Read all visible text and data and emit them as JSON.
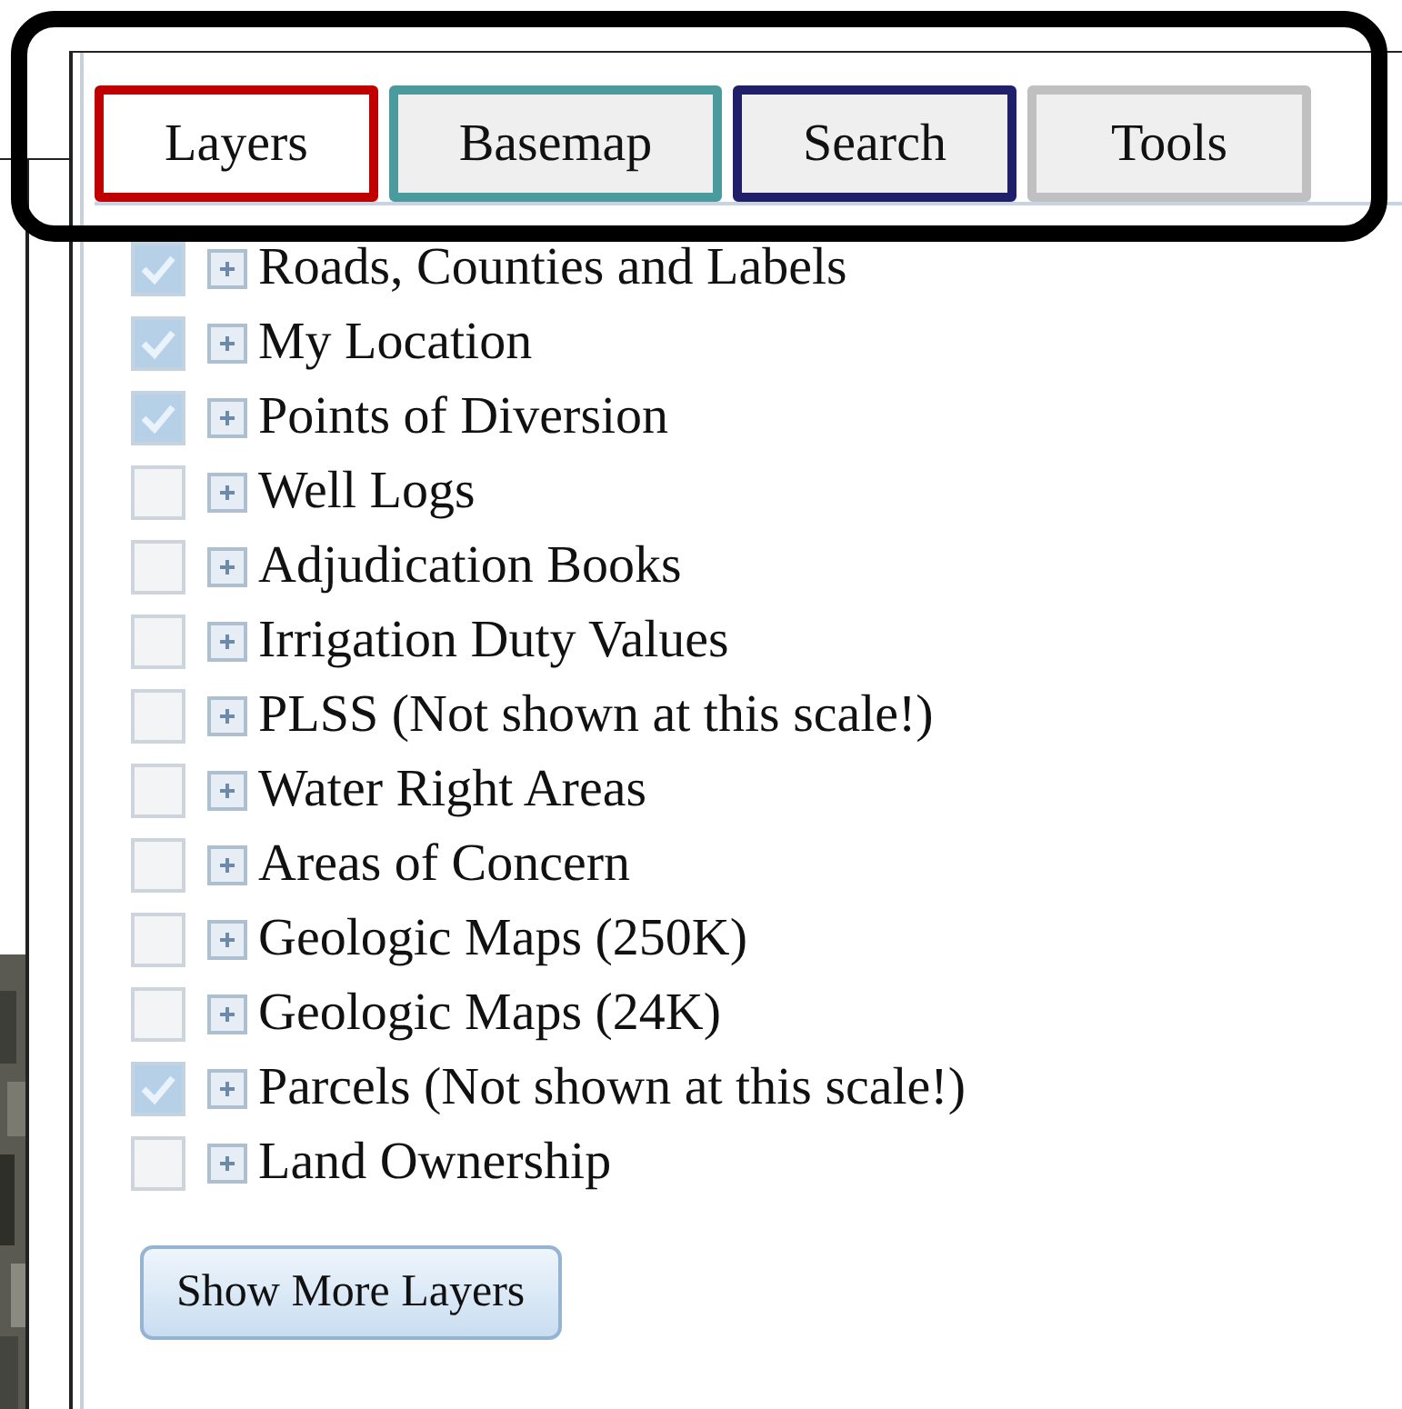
{
  "tabs": [
    {
      "label": "Layers",
      "selected": true,
      "color": "#c00000"
    },
    {
      "label": "Basemap",
      "selected": false,
      "color": "#4a9a9e"
    },
    {
      "label": "Search",
      "selected": false,
      "color": "#20206a"
    },
    {
      "label": "Tools",
      "selected": false,
      "color": "#c0c0c0"
    }
  ],
  "layers": [
    {
      "label": "Roads, Counties and Labels",
      "checked": true
    },
    {
      "label": "My Location",
      "checked": true
    },
    {
      "label": "Points of Diversion",
      "checked": true
    },
    {
      "label": "Well Logs",
      "checked": false
    },
    {
      "label": "Adjudication Books",
      "checked": false
    },
    {
      "label": "Irrigation Duty Values",
      "checked": false
    },
    {
      "label": "PLSS (Not shown at this scale!)",
      "checked": false
    },
    {
      "label": "Water Right Areas",
      "checked": false
    },
    {
      "label": "Areas of Concern",
      "checked": false
    },
    {
      "label": "Geologic Maps (250K)",
      "checked": false
    },
    {
      "label": "Geologic Maps (24K)",
      "checked": false
    },
    {
      "label": "Parcels (Not shown at this scale!)",
      "checked": true
    },
    {
      "label": "Land Ownership",
      "checked": false
    }
  ],
  "show_more_button": "Show More Layers"
}
